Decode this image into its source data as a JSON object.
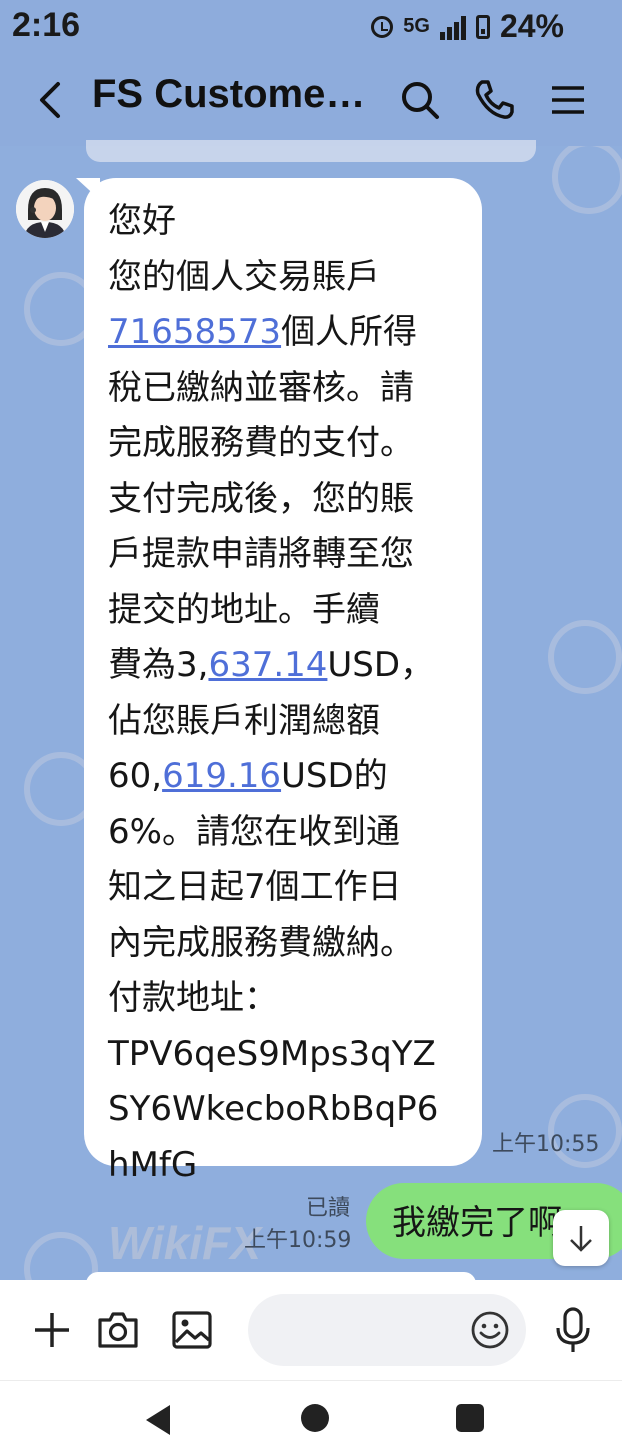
{
  "status_bar": {
    "time": "2:16",
    "network": "5G",
    "battery": "24%"
  },
  "header": {
    "title": "FS Custome…"
  },
  "incoming_message": {
    "lines": [
      "您好",
      "您的個人交易賬戶",
      "71658573個人所得",
      "稅已繳納並審核。請",
      "完成服務費的支付。",
      "支付完成後，您的賬",
      "戶提款申請將轉至您",
      "提交的地址。手續",
      "費為3,637.14USD，",
      "佔您賬戶利潤總額",
      "60,619.16USD的",
      "6%。請您在收到通",
      "知之日起7個工作日",
      "內完成服務費繳納。",
      "付款地址：",
      "TPV6qeS9Mps3qYZ",
      "SY6WkecboRbBqP6",
      "hMfG"
    ],
    "time": "上午10:55"
  },
  "outgoing_message": {
    "text": "我繳完了啊",
    "read_label": "已讀",
    "time": "上午10:59"
  },
  "watermark": "WikiFX",
  "icons": {
    "back": "back-arrow-icon",
    "search": "search-icon",
    "call": "phone-icon",
    "menu": "menu-icon",
    "add": "plus-icon",
    "camera": "camera-icon",
    "gallery": "image-icon",
    "emoji": "emoji-icon",
    "mic": "microphone-icon",
    "scroll": "arrow-down-icon"
  }
}
